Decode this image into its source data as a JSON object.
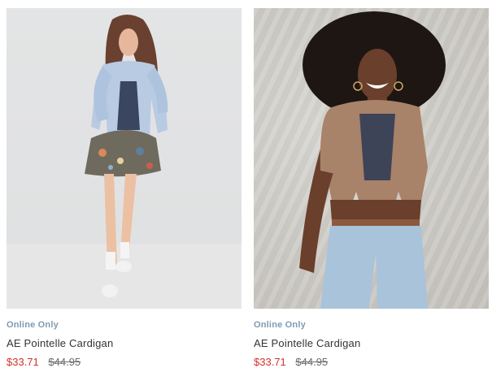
{
  "products": [
    {
      "badge": "Online Only",
      "name": "AE Pointelle Cardigan",
      "sale_price": "$33.71",
      "original_price": "$44.95"
    },
    {
      "badge": "Online Only",
      "name": "AE Pointelle Cardigan",
      "sale_price": "$33.71",
      "original_price": "$44.95"
    }
  ],
  "colors": {
    "badge": "#7e9bb5",
    "sale": "#d0312d",
    "original": "#6b6b6b"
  }
}
